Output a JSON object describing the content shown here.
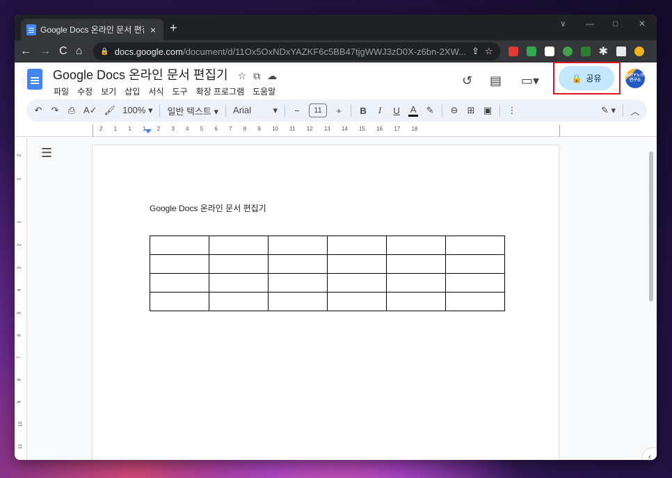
{
  "browser": {
    "tab_title": "Google Docs 온라인 문서 편집기",
    "tab_close": "×",
    "new_tab": "+",
    "url_host": "docs.google.com",
    "url_path": "/document/d/11Ox5OxNDxYAZKF6c5BB47tjgWWJ3zD0X-z6bn-2XW...",
    "window_controls": [
      "∨",
      "—",
      "□",
      "✕"
    ]
  },
  "docs": {
    "title": "Google Docs 온라인 문서 편집기",
    "menus": [
      "파일",
      "수정",
      "보기",
      "삽입",
      "서식",
      "도구",
      "확장 프로그램",
      "도움말"
    ],
    "share_label": "공유",
    "avatar_text": "mITY's IT 연구소"
  },
  "format_toolbar": {
    "zoom": "100%",
    "style": "일반 텍스트",
    "font": "Arial",
    "font_size": "11"
  },
  "ruler": {
    "numbers": "2 1 1 1 2 3 4 5 6 7 8 9 10 11 12 13 14 15 16 17 18"
  },
  "vertical_ruler": [
    "2",
    "1",
    "1",
    "2",
    "3",
    "4",
    "5",
    "6",
    "7",
    "8",
    "9",
    "10",
    "11"
  ],
  "document": {
    "body_text": "Google Docs 온라인 문서 편집기",
    "table": {
      "rows": 4,
      "cols": 6
    }
  }
}
